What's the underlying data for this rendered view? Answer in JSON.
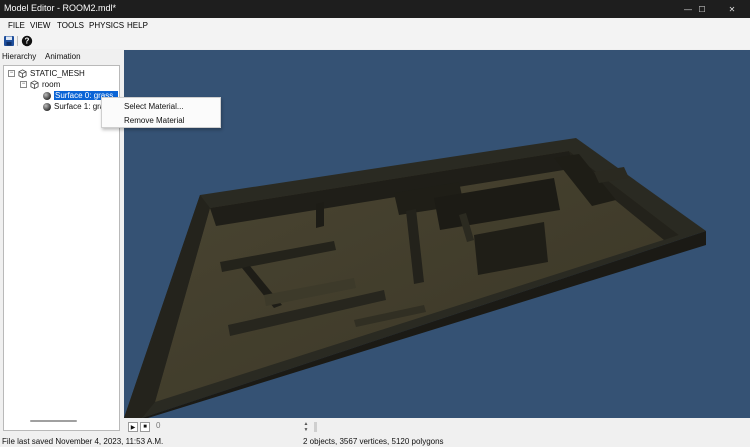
{
  "window": {
    "title": "Model Editor - ROOM2.mdl*",
    "controls": {
      "minimize": "—",
      "maximize": "☐",
      "close": "✕"
    }
  },
  "menu": [
    "FILE",
    "VIEW",
    "TOOLS",
    "PHYSICS",
    "HELP"
  ],
  "toolbar": {
    "icons": [
      "save-icon",
      "help-icon"
    ]
  },
  "panel": {
    "tabs": [
      "Hierarchy",
      "Animation"
    ],
    "active_tab": "Hierarchy",
    "tree": [
      {
        "label": "STATIC_MESH",
        "icon": "cube-icon",
        "expander": "−"
      },
      {
        "label": "room",
        "icon": "cube-icon",
        "expander": "−"
      },
      {
        "label": "Surface 0: grass_d",
        "icon": "sphere-icon",
        "selected": true
      },
      {
        "label": "Surface 1: gra",
        "icon": "sphere-icon",
        "selected": false
      }
    ]
  },
  "context_menu": {
    "items": [
      "Select Material...",
      "Remove Material"
    ]
  },
  "viewport": {
    "background": "#355274",
    "scene": "3D room mesh"
  },
  "playback": {
    "play": "▶",
    "stop": "■",
    "frame": "0"
  },
  "status": {
    "left": "File last saved November 4, 2023, 11:53 A.M.",
    "right": "2 objects, 3567 vertices, 5120 polygons"
  },
  "colors": {
    "titlebar": "#1e1e1e",
    "selection": "#0a64d6",
    "viewport": "#355274"
  }
}
